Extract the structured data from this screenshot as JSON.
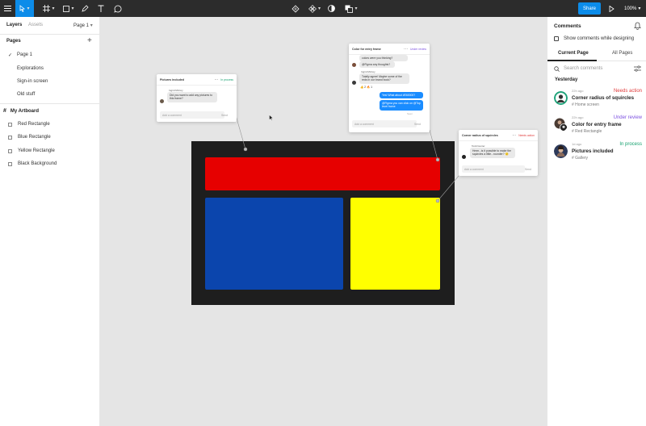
{
  "colors": {
    "accent": "#0c8ce9",
    "toolbar": "#2c2c2c",
    "canvas": "#e5e5e5",
    "artboard": "#1e1e1e",
    "red_rect": "#e60000",
    "blue_rect": "#0b45ad",
    "yellow_rect": "#ffff00",
    "needs_action": "#e03a3a",
    "under_review": "#7b4fe0",
    "in_process": "#14a06e"
  },
  "toolbar": {
    "share_label": "Share",
    "zoom": "100%",
    "icons": [
      "menu-icon",
      "move-icon",
      "frame-icon",
      "shape-icon",
      "pen-icon",
      "text-icon",
      "comment-icon",
      "component-icon",
      "mask-icon",
      "contrast-icon",
      "boolean-icon",
      "play-icon"
    ]
  },
  "left_panel": {
    "tabs": {
      "layers": "Layers",
      "assets": "Assets"
    },
    "page_select": "Page 1",
    "pages_heading": "Pages",
    "pages": [
      {
        "label": "Page 1",
        "selected": true
      },
      {
        "label": "Explorations",
        "selected": false
      },
      {
        "label": "Sign-in screen",
        "selected": false
      },
      {
        "label": "Old stuff",
        "selected": false
      }
    ],
    "artboard": "My Artboard",
    "layers": [
      "Red Rectangle",
      "Blue Rectangle",
      "Yellow Rectangle",
      "Black Background"
    ]
  },
  "canvas": {
    "thread_pictures": {
      "title": "Pictures included",
      "status": "In process",
      "author": "Ingrid McCoy",
      "message": "Did you want to add any pictures to this frame?",
      "input_placeholder": "Add a comment",
      "send": "Send"
    },
    "thread_color": {
      "title": "Color for entry frame",
      "status": "Under review",
      "msg1": "colors were you thinking?",
      "msg2": "@Figma any thoughts?",
      "author2": "Ingrid McCoy",
      "msg3": "Totally agree! Maybe some of the reds in our brand book?",
      "reactions": "👍 2   🔥 1",
      "mine1": "Yes! What about #E60000?",
      "mine2": "@Figma you can click on @Top level frame",
      "seen": "Seen",
      "input_placeholder": "Add a comment",
      "send": "Send"
    },
    "thread_corner": {
      "title": "Corner radius of squircles",
      "status": "Needs action",
      "author": "Todd Gunter",
      "message": "Hmm...is it possible to make the squircles a little...rounder? 🙂",
      "input_placeholder": "Add a comment",
      "send": "Send"
    }
  },
  "right_panel": {
    "title": "Comments",
    "show_while_designing": "Show comments while designing",
    "tabs": {
      "current": "Current Page",
      "all": "All Pages"
    },
    "search_placeholder": "Search comments",
    "section": "Yesterday",
    "comments": [
      {
        "time": "22h ago",
        "status": "Needs action",
        "title": "Corner radius of squircles",
        "location": "Home screen"
      },
      {
        "time": "22h ago",
        "status": "Under review",
        "title": "Color for entry frame",
        "location": "Red Rectangle"
      },
      {
        "time": "1d ago",
        "status": "In process",
        "title": "Pictures included",
        "location": "Gallery"
      }
    ]
  }
}
